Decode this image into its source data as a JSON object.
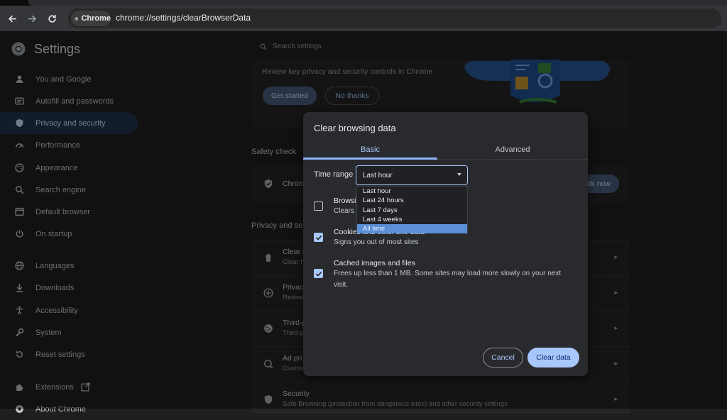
{
  "browser": {
    "chip_label": "Chrome",
    "url": "chrome://settings/clearBrowserData"
  },
  "sidebar": {
    "title": "Settings",
    "items": [
      {
        "label": "You and Google",
        "icon": "person-icon"
      },
      {
        "label": "Autofill and passwords",
        "icon": "key-icon"
      },
      {
        "label": "Privacy and security",
        "icon": "shield-icon"
      },
      {
        "label": "Performance",
        "icon": "speedometer-icon"
      },
      {
        "label": "Appearance",
        "icon": "palette-icon"
      },
      {
        "label": "Search engine",
        "icon": "search-icon"
      },
      {
        "label": "Default browser",
        "icon": "browser-icon"
      },
      {
        "label": "On startup",
        "icon": "power-icon"
      },
      {
        "label": "Languages",
        "icon": "globe-icon"
      },
      {
        "label": "Downloads",
        "icon": "download-icon"
      },
      {
        "label": "Accessibility",
        "icon": "accessibility-icon"
      },
      {
        "label": "System",
        "icon": "wrench-icon"
      },
      {
        "label": "Reset settings",
        "icon": "reset-icon"
      },
      {
        "label": "Extensions",
        "icon": "puzzle-icon"
      },
      {
        "label": "About Chrome",
        "icon": "chrome-icon"
      }
    ]
  },
  "search": {
    "placeholder": "Search settings"
  },
  "privacy_guide": {
    "text": "Review key privacy and security controls in Chrome",
    "get_started": "Get started",
    "no_thanks": "No thanks"
  },
  "safety_check": {
    "title": "Safety check",
    "row_text": "Chrom",
    "button": "ck now"
  },
  "privacy_section": {
    "title": "Privacy and se",
    "rows": [
      {
        "title": "Clear b",
        "sub": "Clear h",
        "icon": "trash-icon"
      },
      {
        "title": "Privacy",
        "sub": "Review",
        "icon": "add-circle-icon"
      },
      {
        "title": "Third-p",
        "sub": "Third-p",
        "icon": "cookie-icon"
      },
      {
        "title": "Ad pri",
        "sub": "Custom",
        "icon": "ad-privacy-icon"
      },
      {
        "title": "Security",
        "sub": "Safe Browsing (protection from dangerous sites) and other security settings",
        "icon": "shield-icon"
      }
    ]
  },
  "dialog": {
    "title": "Clear browsing data",
    "tabs": [
      "Basic",
      "Advanced"
    ],
    "time_range_label": "Time range",
    "time_range_value": "Last hour",
    "time_range_options": [
      "Last hour",
      "Last 24 hours",
      "Last 7 days",
      "Last 4 weeks",
      "All time"
    ],
    "items": [
      {
        "title": "Browsi",
        "desc": "Clears l",
        "checked": false
      },
      {
        "title": "Cookies and other site data",
        "desc": "Signs you out of most sites",
        "checked": true
      },
      {
        "title": "Cached images and files",
        "desc": "Frees up less than 1 MB. Some sites may load more slowly on your next visit.",
        "checked": true
      }
    ],
    "cancel": "Cancel",
    "clear": "Clear data"
  },
  "colors": {
    "accent": "#a8c7fa",
    "active_nav": "#24344e",
    "page_bg": "#1f1f1f",
    "dialog_bg": "#292a2d"
  }
}
